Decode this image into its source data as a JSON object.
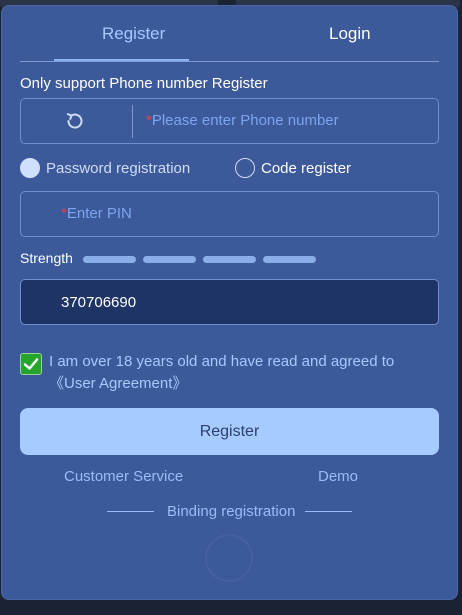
{
  "tabs": {
    "register_label": "Register",
    "login_label": "Login"
  },
  "form": {
    "notice": "Only support Phone number Register",
    "phone": {
      "required_mark": "*",
      "placeholder": "Please enter Phone number"
    },
    "registration_mode": {
      "password_label": "Password registration",
      "code_label": "Code register",
      "selected": "Password registration"
    },
    "pin": {
      "required_mark": "*",
      "placeholder": "Enter PIN"
    },
    "strength": {
      "label": "Strength",
      "segments": 4
    },
    "code_value": "370706690",
    "agreement": {
      "checked": true,
      "text": "I am over 18 years old and have read and agreed to 《User Agreement》"
    },
    "register_button": "Register"
  },
  "links": {
    "customer_service": "Customer Service",
    "demo": "Demo",
    "binding_registration": "Binding registration"
  },
  "colors": {
    "panel": "#3c5999",
    "accent": "#a6ccff",
    "checkbox": "#25a52c",
    "required": "#e24545"
  },
  "icons": {
    "refresh": "refresh-icon",
    "check": "check-icon",
    "spinner": "loading-spinner-icon"
  }
}
